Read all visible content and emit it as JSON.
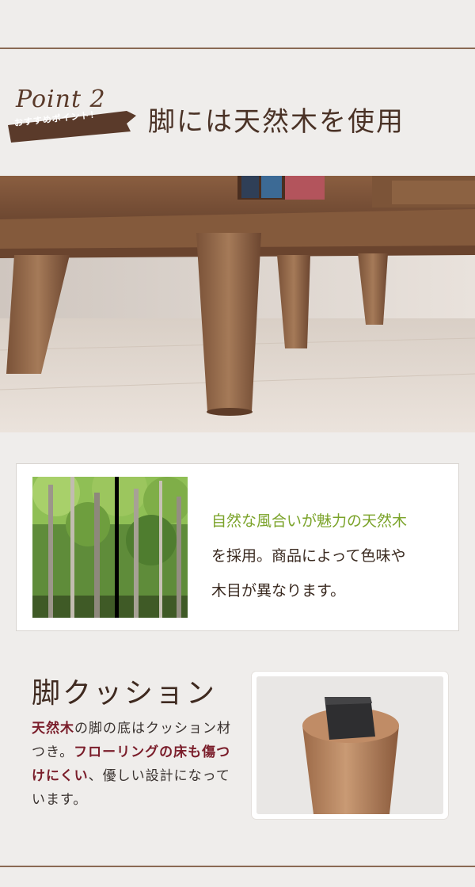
{
  "point": {
    "title": "Point 2",
    "ribbon": "おすすめポイント！"
  },
  "section_title": "脚には天然木を使用",
  "card": {
    "line1": "自然な風合いが魅力の天然木",
    "line2": "を採用。商品によって色味や",
    "line3": "木目が異なります。"
  },
  "cushion": {
    "title": "脚クッション",
    "segments": [
      {
        "text": "天然木",
        "hl": true
      },
      {
        "text": "の脚の底はクッション材つき。",
        "hl": false
      },
      {
        "text": "フローリングの床も傷つけにくい",
        "hl": true
      },
      {
        "text": "、優しい設計になっています。",
        "hl": false
      }
    ]
  },
  "colors": {
    "accent": "#7a1d2a",
    "green": "#7ba32a",
    "brown": "#5a3a2a",
    "background": "#efedeb"
  }
}
